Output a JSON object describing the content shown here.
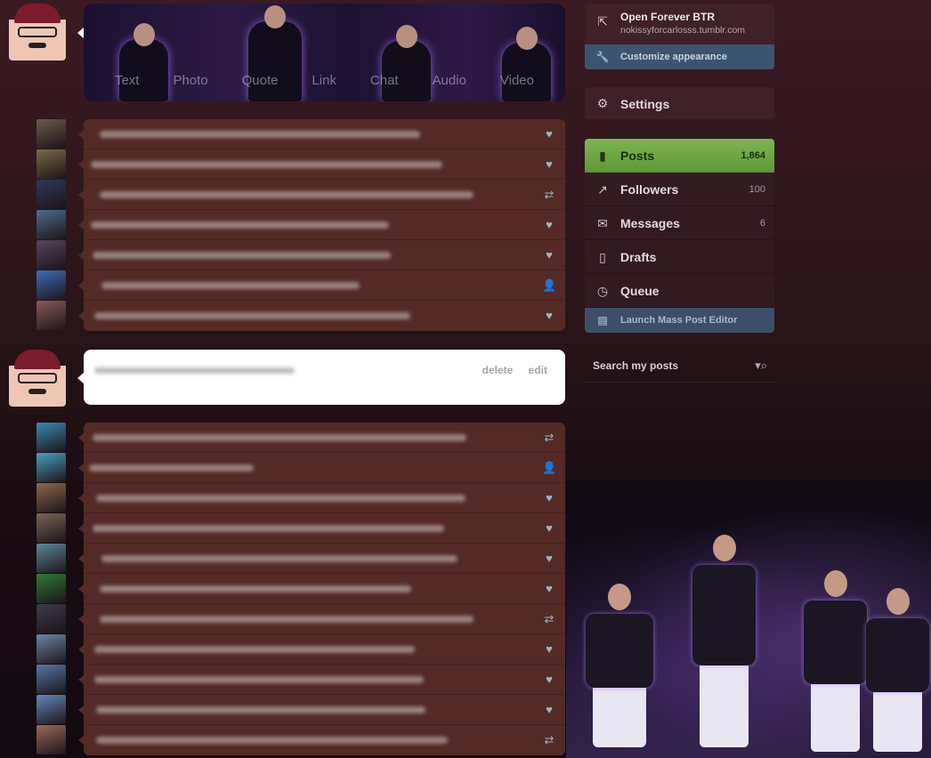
{
  "composer": {
    "post_types": [
      "Text",
      "Photo",
      "Quote",
      "Link",
      "Chat",
      "Audio",
      "Video"
    ]
  },
  "white_post": {
    "delete_label": "delete",
    "edit_label": "edit"
  },
  "list1": {
    "rows": [
      {
        "icon": "heart-icon",
        "glyph": "♥"
      },
      {
        "icon": "heart-icon",
        "glyph": "♥"
      },
      {
        "icon": "reblog-icon",
        "glyph": "⇄"
      },
      {
        "icon": "heart-icon",
        "glyph": "♥"
      },
      {
        "icon": "heart-icon",
        "glyph": "♥"
      },
      {
        "icon": "follow-icon",
        "glyph": "👤"
      },
      {
        "icon": "heart-icon",
        "glyph": "♥"
      }
    ]
  },
  "list2": {
    "rows": [
      {
        "icon": "reblog-icon",
        "glyph": "⇄"
      },
      {
        "icon": "follow-icon",
        "glyph": "👤"
      },
      {
        "icon": "heart-icon",
        "glyph": "♥"
      },
      {
        "icon": "heart-icon",
        "glyph": "♥"
      },
      {
        "icon": "heart-icon",
        "glyph": "♥"
      },
      {
        "icon": "heart-icon",
        "glyph": "♥"
      },
      {
        "icon": "reblog-icon",
        "glyph": "⇄"
      },
      {
        "icon": "heart-icon",
        "glyph": "♥"
      },
      {
        "icon": "heart-icon",
        "glyph": "♥"
      },
      {
        "icon": "heart-icon",
        "glyph": "♥"
      },
      {
        "icon": "reblog-icon",
        "glyph": "⇄"
      }
    ]
  },
  "sidebar": {
    "blog_title": "Open Forever BTR",
    "blog_url": "nokissyforcarlosss.tumblr.com",
    "customize_label": "Customize appearance",
    "settings_label": "Settings",
    "nav": [
      {
        "label": "Posts",
        "count": "1,864",
        "icon": "document-icon",
        "glyph": "▮"
      },
      {
        "label": "Followers",
        "count": "100",
        "icon": "chart-icon",
        "glyph": "↗"
      },
      {
        "label": "Messages",
        "count": "6",
        "icon": "envelope-icon",
        "glyph": "✉"
      },
      {
        "label": "Drafts",
        "count": "",
        "icon": "draft-icon",
        "glyph": "▯"
      },
      {
        "label": "Queue",
        "count": "",
        "icon": "clock-icon",
        "glyph": "◷"
      }
    ],
    "mass_editor_label": "Launch Mass Post Editor",
    "search_placeholder": "Search my posts"
  },
  "colors": {
    "active_nav": "#6fa945",
    "list_bg": "#532a25",
    "accent_blue": "#3c5470"
  }
}
